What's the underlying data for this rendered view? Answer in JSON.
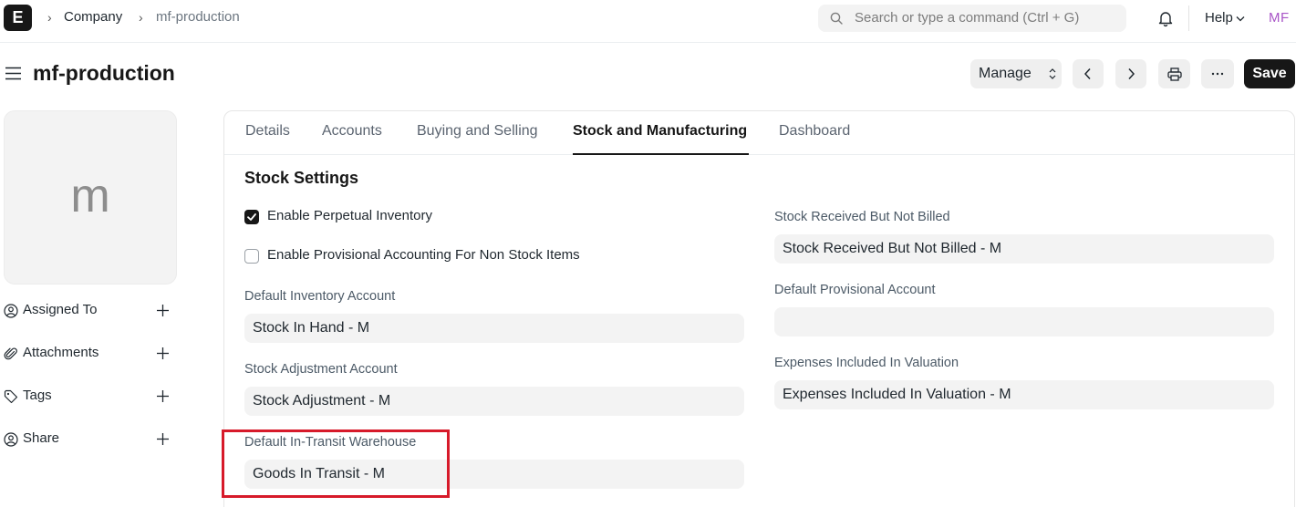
{
  "navbar": {
    "logo_letter": "E",
    "breadcrumbs": [
      "Company",
      "mf-production"
    ],
    "search_placeholder": "Search or type a command (Ctrl + G)",
    "help_label": "Help",
    "user_initials": "MF"
  },
  "page": {
    "title": "mf-production",
    "manage_label": "Manage",
    "save_label": "Save"
  },
  "sidebar": {
    "image_letter": "m",
    "items": [
      {
        "label": "Assigned To",
        "icon": "assign-user-icon"
      },
      {
        "label": "Attachments",
        "icon": "paperclip-icon"
      },
      {
        "label": "Tags",
        "icon": "tag-icon"
      },
      {
        "label": "Share",
        "icon": "share-user-icon"
      }
    ]
  },
  "tabs": [
    {
      "label": "Details",
      "active": false
    },
    {
      "label": "Accounts",
      "active": false
    },
    {
      "label": "Buying and Selling",
      "active": false
    },
    {
      "label": "Stock and Manufacturing",
      "active": true
    },
    {
      "label": "Dashboard",
      "active": false
    }
  ],
  "form": {
    "section_title": "Stock Settings",
    "checkboxes": [
      {
        "label": "Enable Perpetual Inventory",
        "checked": true
      },
      {
        "label": "Enable Provisional Accounting For Non Stock Items",
        "checked": false
      }
    ],
    "left_fields": [
      {
        "label": "Default Inventory Account",
        "value": "Stock In Hand - M"
      },
      {
        "label": "Stock Adjustment Account",
        "value": "Stock Adjustment - M"
      },
      {
        "label": "Default In-Transit Warehouse",
        "value": "Goods In Transit - M"
      }
    ],
    "right_fields": [
      {
        "label": "Stock Received But Not Billed",
        "value": "Stock Received But Not Billed - M"
      },
      {
        "label": "Default Provisional Account",
        "value": ""
      },
      {
        "label": "Expenses Included In Valuation",
        "value": "Expenses Included In Valuation - M"
      }
    ]
  },
  "colors": {
    "accent_dark": "#171717",
    "highlight_red": "#d71a2a",
    "avatar_purple": "#a855c7"
  }
}
